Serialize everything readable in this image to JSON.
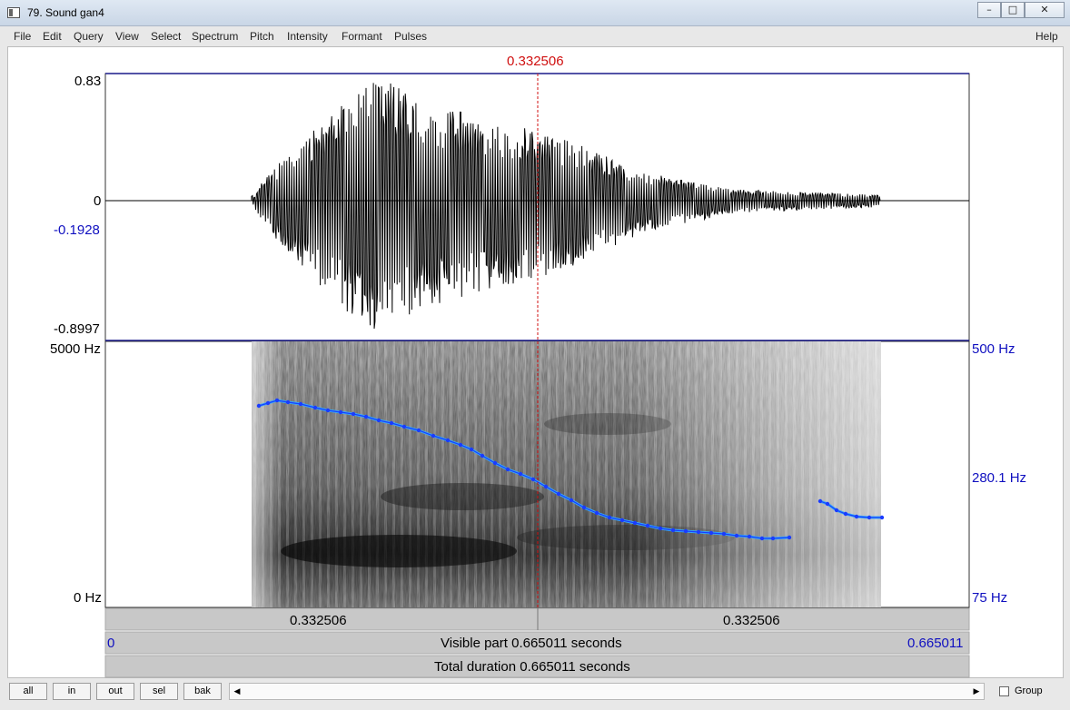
{
  "window": {
    "title": "79. Sound gan4",
    "buttons": [
      "minimize-icon",
      "maximize-icon",
      "close-icon"
    ]
  },
  "menu": [
    "File",
    "Edit",
    "Query",
    "View",
    "Select",
    "Spectrum",
    "Pitch",
    "Intensity",
    "Formant",
    "Pulses"
  ],
  "help_label": "Help",
  "cursor_time": "0.332506",
  "waveform": {
    "max_label": "0.83",
    "zero_label": "0",
    "cursor_value": "-0.1928",
    "min_label": "-0.8997"
  },
  "spectrogram": {
    "top_label": "5000 Hz",
    "bottom_label": "0 Hz"
  },
  "pitch": {
    "top_label": "500 Hz",
    "cursor_label": "280.1 Hz",
    "bottom_label": "75 Hz",
    "color": "#1a3cff",
    "curve_line_color": "#33aaff"
  },
  "time_bar": {
    "left_segment": "0.332506",
    "right_segment": "0.332506"
  },
  "visible_bar": {
    "start": "0",
    "label": "Visible part 0.665011 seconds",
    "end": "0.665011"
  },
  "total_bar": {
    "label": "Total duration 0.665011 seconds"
  },
  "buttons": [
    "all",
    "in",
    "out",
    "sel",
    "bak"
  ],
  "group_label": "Group"
}
